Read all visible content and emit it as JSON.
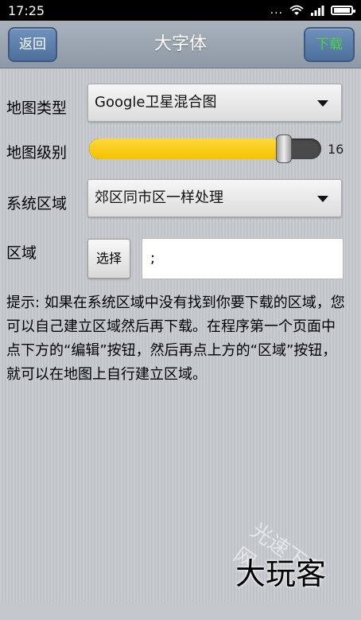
{
  "status_bar": {
    "time": "17:25",
    "indicators": "...",
    "icons": [
      "wifi-icon",
      "signal-icon",
      "battery-icon"
    ]
  },
  "header": {
    "title": "大字体",
    "back_label": "返回",
    "download_label": "下载",
    "download_color": "#4ad248"
  },
  "form": {
    "map_type": {
      "label": "地图类型",
      "selected": "Google卫星混合图"
    },
    "map_level": {
      "label": "地图级别",
      "value": "16",
      "fill_fraction": 0.84,
      "fill_color": "#f5c200"
    },
    "system_region": {
      "label": "系统区域",
      "selected": "郊区同市区一样处理"
    },
    "region": {
      "label": "区域",
      "select_button": "选择",
      "input_value": ";"
    }
  },
  "hint_text": "提示: 如果在系统区域中没有找到你要下载的区域，您可以自己建立区域然后再下载。在程序第一个页面中点下方的“编辑”按钮，然后再点上方的“区域”按钮，就可以在地图上自行建立区域。",
  "watermark": {
    "main": "大玩客",
    "faint": "光速下载网"
  }
}
